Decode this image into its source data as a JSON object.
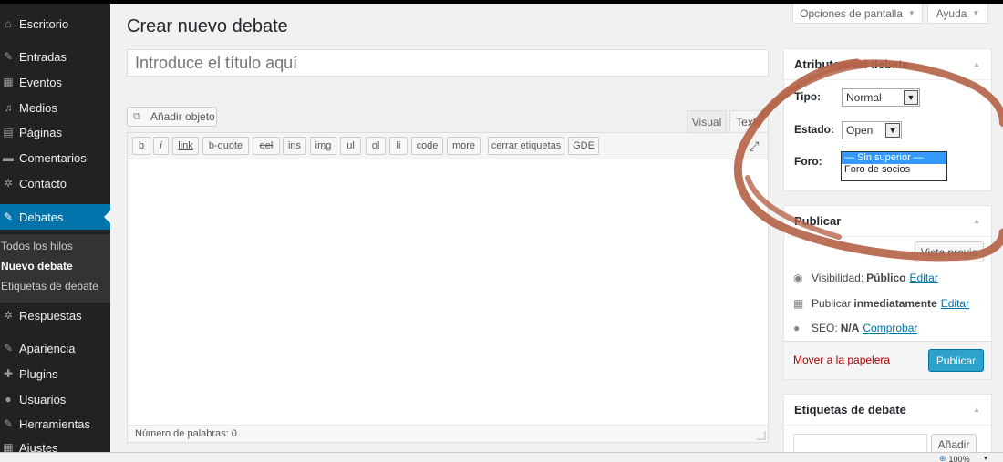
{
  "sidebar": {
    "items": [
      {
        "label": "Escritorio",
        "icon": "dashboard-icon",
        "glyph": "⌂"
      },
      {
        "label": "Entradas",
        "icon": "pin-icon",
        "glyph": "✎"
      },
      {
        "label": "Eventos",
        "icon": "calendar-icon",
        "glyph": "▦"
      },
      {
        "label": "Medios",
        "icon": "media-icon",
        "glyph": "♫"
      },
      {
        "label": "Páginas",
        "icon": "pages-icon",
        "glyph": "▤"
      },
      {
        "label": "Comentarios",
        "icon": "comments-icon",
        "glyph": "▬"
      },
      {
        "label": "Contacto",
        "icon": "gear-icon",
        "glyph": "✲"
      },
      {
        "label": "Debates",
        "icon": "forum-icon",
        "glyph": "✎"
      },
      {
        "label": "Respuestas",
        "icon": "replies-icon",
        "glyph": "✲"
      },
      {
        "label": "Apariencia",
        "icon": "brush-icon",
        "glyph": "✎"
      },
      {
        "label": "Plugins",
        "icon": "plug-icon",
        "glyph": "✚"
      },
      {
        "label": "Usuarios",
        "icon": "user-icon",
        "glyph": "●"
      },
      {
        "label": "Herramientas",
        "icon": "wrench-icon",
        "glyph": "✎"
      },
      {
        "label": "Ajustes",
        "icon": "settings-icon",
        "glyph": "▦"
      }
    ],
    "submenu": [
      {
        "label": "Todos los hilos"
      },
      {
        "label": "Nuevo debate"
      },
      {
        "label": "Etiquetas de debate"
      }
    ]
  },
  "screen_meta": {
    "options": "Opciones de pantalla",
    "help": "Ayuda"
  },
  "page": {
    "title": "Crear nuevo debate",
    "title_placeholder": "Introduce el título aquí"
  },
  "editor": {
    "add_media": "Añadir objeto",
    "tab_visual": "Visual",
    "tab_text": "Texto",
    "quicktags": [
      "b",
      "i",
      "link",
      "b-quote",
      "del",
      "ins",
      "img",
      "ul",
      "ol",
      "li",
      "code",
      "more",
      "cerrar etiquetas",
      "GDE"
    ],
    "word_count": "Número de palabras: 0"
  },
  "attributes": {
    "title": "Atributos del debate",
    "type_label": "Tipo:",
    "type_value": "Normal",
    "status_label": "Estado:",
    "status_value": "Open",
    "forum_label": "Foro:",
    "forum_options": [
      "— Sin superior —",
      "Foro de socios"
    ]
  },
  "publish": {
    "title": "Publicar",
    "preview": "Vista previa",
    "visibility_label": "Visibilidad:",
    "visibility_value": "Público",
    "edit": "Editar",
    "publish_label": "Publicar",
    "publish_value": "inmediatamente",
    "seo_label": "SEO:",
    "seo_value": "N/A",
    "seo_check": "Comprobar",
    "trash": "Mover a la papelera",
    "publish_button": "Publicar"
  },
  "tags": {
    "title": "Etiquetas de debate",
    "add": "Añadir"
  },
  "statusbar": {
    "zoom": "100%"
  },
  "colors": {
    "accent": "#0073aa",
    "annotation": "#b5654a"
  }
}
